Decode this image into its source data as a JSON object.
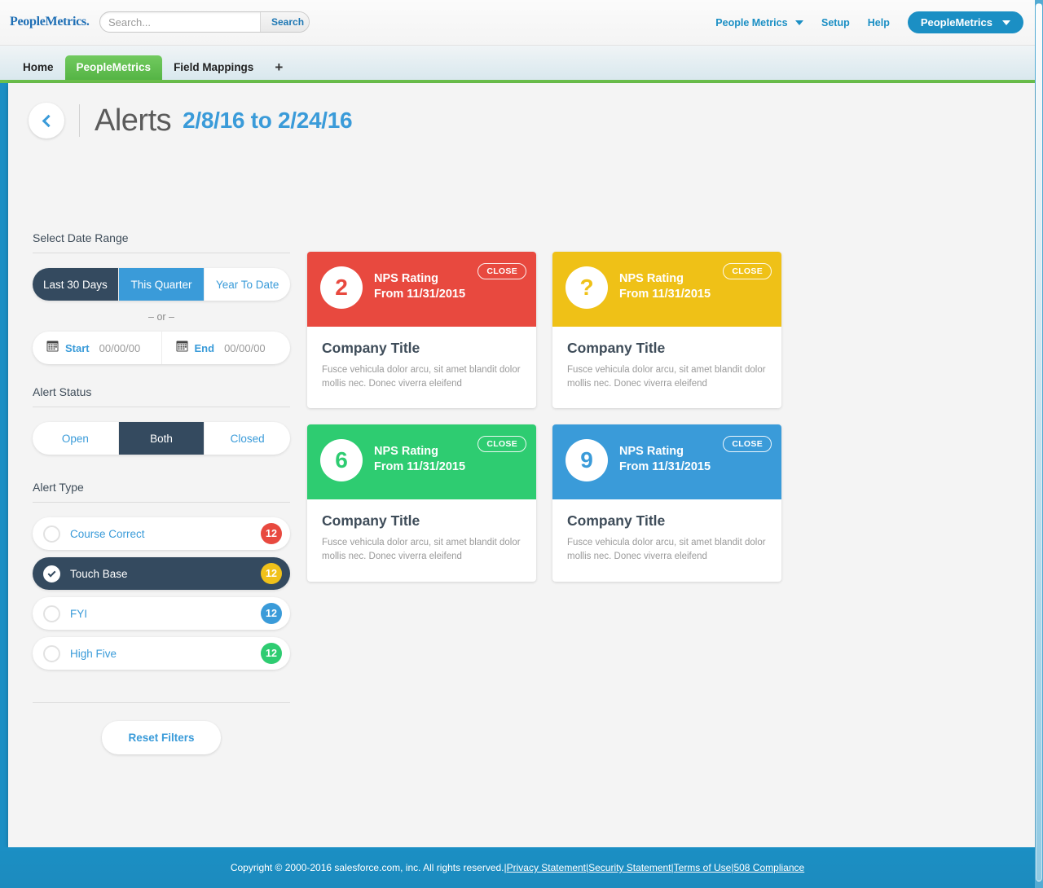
{
  "header": {
    "logo": "PeopleMetrics.",
    "search": {
      "value": "",
      "placeholder": "Search...",
      "button": "Search"
    },
    "nav": [
      {
        "label": "People Metrics",
        "caret": true
      },
      {
        "label": "Setup",
        "caret": false
      },
      {
        "label": "Help",
        "caret": false
      }
    ],
    "user_menu": "PeopleMetrics"
  },
  "tabs": {
    "items": [
      {
        "label": "Home",
        "active": false
      },
      {
        "label": "PeopleMetrics",
        "active": true
      },
      {
        "label": "Field Mappings",
        "active": false
      }
    ],
    "add_label": "+"
  },
  "page": {
    "back_icon": "chevron-left-icon",
    "title": "Alerts",
    "date_range": "2/8/16 to 2/24/16"
  },
  "filters": {
    "date_range": {
      "label": "Select Date Range",
      "options": [
        {
          "label": "Last 30 Days",
          "state": "dark"
        },
        {
          "label": "This Quarter",
          "state": "blue"
        },
        {
          "label": "Year To Date",
          "state": "plain"
        }
      ],
      "or_text": "– or –",
      "start": {
        "label": "Start",
        "value": "00/00/00",
        "icon": "calendar-icon"
      },
      "end": {
        "label": "End",
        "value": "00/00/00",
        "icon": "calendar-icon"
      }
    },
    "alert_status": {
      "label": "Alert Status",
      "options": [
        {
          "label": "Open",
          "state": "plain"
        },
        {
          "label": "Both",
          "state": "dark"
        },
        {
          "label": "Closed",
          "state": "plain"
        }
      ]
    },
    "alert_type": {
      "label": "Alert Type",
      "options": [
        {
          "label": "Course Correct",
          "count": "12",
          "color": "#e8493f",
          "selected": false
        },
        {
          "label": "Touch Base",
          "count": "12",
          "color": "#f0c11a",
          "selected": true
        },
        {
          "label": "FYI",
          "count": "12",
          "color": "#3a9bd9",
          "selected": false
        },
        {
          "label": "High Five",
          "count": "12",
          "color": "#2ecc71",
          "selected": false
        }
      ]
    },
    "reset_label": "Reset Filters"
  },
  "alerts": [
    {
      "score": "2",
      "accent": "#e8493f",
      "metric": "NPS Rating",
      "from": "From 11/31/2015",
      "close_label": "CLOSE",
      "title": "Company Title",
      "description": "Fusce vehicula dolor arcu, sit amet blandit dolor mollis nec. Donec viverra eleifend"
    },
    {
      "score": "?",
      "accent": "#efc117",
      "metric": "NPS Rating",
      "from": "From 11/31/2015",
      "close_label": "CLOSE",
      "title": "Company Title",
      "description": "Fusce vehicula dolor arcu, sit amet blandit dolor mollis nec. Donec viverra eleifend"
    },
    {
      "score": "6",
      "accent": "#2ecc71",
      "metric": "NPS Rating",
      "from": "From 11/31/2015",
      "close_label": "CLOSE",
      "title": "Company Title",
      "description": "Fusce vehicula dolor arcu, sit amet blandit dolor mollis nec. Donec viverra eleifend"
    },
    {
      "score": "9",
      "accent": "#3a9bd9",
      "metric": "NPS Rating",
      "from": "From 11/31/2015",
      "close_label": "CLOSE",
      "title": "Company Title",
      "description": "Fusce vehicula dolor arcu, sit amet blandit dolor mollis nec. Donec viverra eleifend"
    }
  ],
  "footer": {
    "copyright": "Copyright © 2000-2016 salesforce.com, inc. All rights reserved.",
    "sep": " | ",
    "links": [
      "Privacy Statement",
      "Security Statement",
      "Terms of Use",
      "508 Compliance"
    ]
  }
}
